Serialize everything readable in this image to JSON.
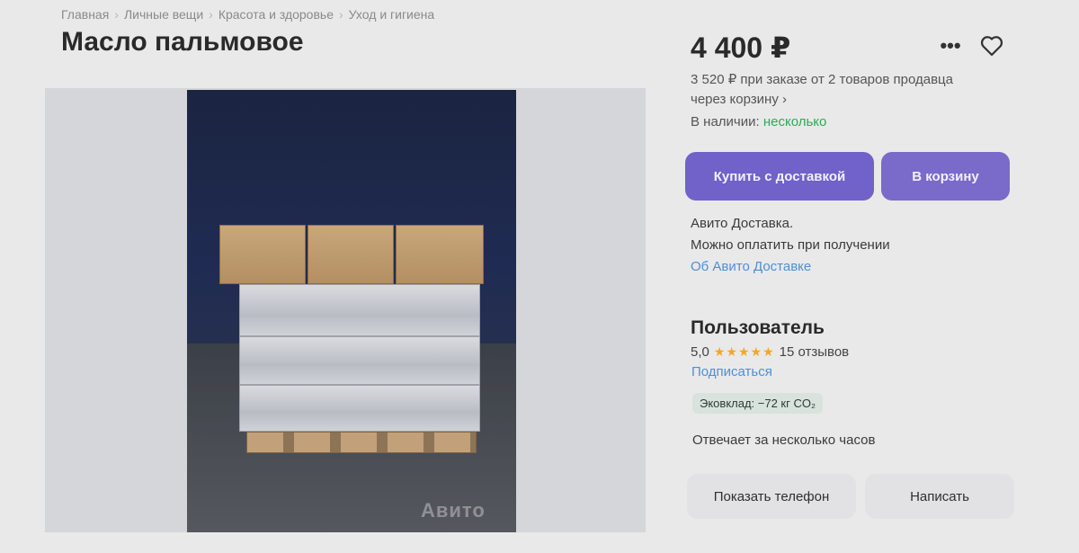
{
  "breadcrumb": [
    "Главная",
    "Личные вещи",
    "Красота и здоровье",
    "Уход и гигиена"
  ],
  "title": "Масло пальмовое",
  "price": "4 400 ₽",
  "discount_line": "3 520 ₽ при заказе от 2 товаров продавца",
  "discount_link": "через корзину ›",
  "stock_label": "В наличии:",
  "stock_value": "несколько",
  "buttons": {
    "buy": "Купить с доставкой",
    "cart": "В корзину",
    "phone": "Показать телефон",
    "write": "Написать"
  },
  "delivery": {
    "line1": "Авито Доставка.",
    "line2": "Можно оплатить при получении",
    "link": "Об Авито Доставке"
  },
  "seller": {
    "name": "Пользователь",
    "rating": "5,0",
    "stars": "★★★★★",
    "reviews": "15 отзывов",
    "subscribe": "Подписаться",
    "eco": "Эковклад: −72 кг CO₂",
    "responds": "Отвечает за несколько часов"
  },
  "photo": {
    "watermark": "Авито"
  },
  "icons": {
    "more": "more-icon",
    "favorite": "heart-icon"
  },
  "colors": {
    "accent": "#7062c9",
    "link": "#4e8fd4",
    "in_stock": "#33a853",
    "stars": "#f5a623"
  }
}
